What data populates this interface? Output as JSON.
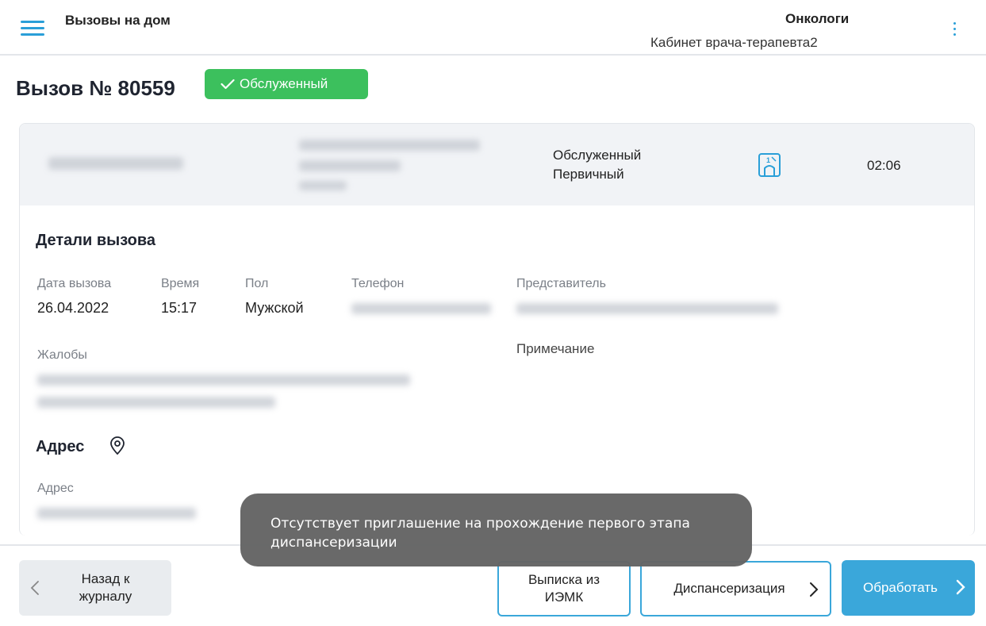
{
  "header": {
    "app_title": "Вызовы на дом",
    "org_name": "Онкологи",
    "cabinet": "Кабинет врача-терапевта2",
    "menu_icon": "hamburger-icon",
    "more_icon": "kebab-menu-icon"
  },
  "call": {
    "title": "Вызов № 80559",
    "status_badge": "Обслуженный"
  },
  "summary": {
    "status": "Обслуженный",
    "type": "Первичный",
    "time": "02:06"
  },
  "details": {
    "section_title": "Детали вызова",
    "date_label": "Дата вызова",
    "date_value": "26.04.2022",
    "time_label": "Время",
    "time_value": "15:17",
    "gender_label": "Пол",
    "gender_value": "Мужской",
    "phone_label": "Телефон",
    "representative_label": "Представитель",
    "complaints_label": "Жалобы",
    "note_label": "Примечание"
  },
  "address": {
    "section_title": "Адрес",
    "label": "Адрес"
  },
  "toast": {
    "message": "Отсутствует приглашение на прохождение первого этапа диспансеризации"
  },
  "footer": {
    "back_label_1": "Назад к",
    "back_label_2": "журналу",
    "emk_label_1": "Выписка из",
    "emk_label_2": "ИЭМК",
    "dispensary_label": "Диспансеризация",
    "process_label": "Обработать"
  },
  "colors": {
    "accent": "#3aa7da",
    "success": "#3cc05d"
  }
}
